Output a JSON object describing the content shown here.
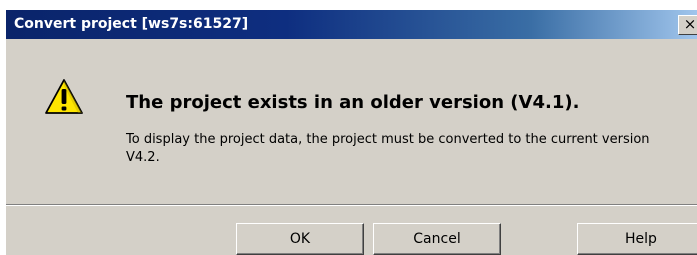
{
  "dialog": {
    "title": "Convert project [ws7s:61527]",
    "close_glyph": "×",
    "icon": "warning-icon",
    "headline": "The project exists in an older version (V4.1).",
    "message": "To display the project data, the project must be converted to the current version V4.2."
  },
  "buttons": {
    "ok_label": "OK",
    "cancel_label": "Cancel",
    "help_label": "Help"
  },
  "colors": {
    "titlebar": "#0a246a",
    "face": "#d4d0c8",
    "warning_yellow": "#ffe600"
  }
}
